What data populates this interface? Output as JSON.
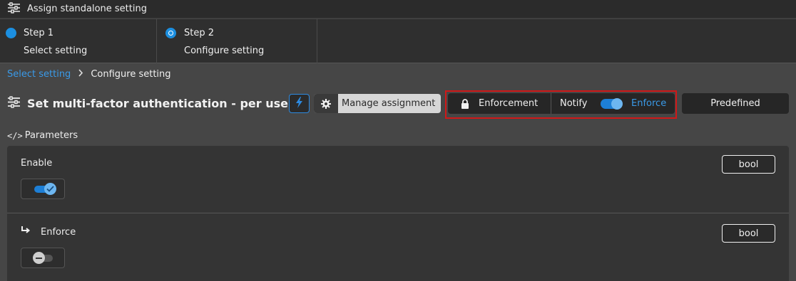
{
  "window": {
    "title": "Assign standalone setting",
    "icon": "sliders-icon"
  },
  "steps": [
    {
      "title": "Step 1",
      "subtitle": "Select setting",
      "state": "completed"
    },
    {
      "title": "Step 2",
      "subtitle": "Configure setting",
      "state": "current"
    }
  ],
  "breadcrumb": {
    "link": "Select setting",
    "current": "Configure setting"
  },
  "header": {
    "title": "Set multi-factor authentication - per user",
    "title_icon": "sliders-icon",
    "quick_action_icon": "lightning-icon",
    "manage_label": "Manage assignment",
    "manage_icon": "gear-icon"
  },
  "enforcement": {
    "label": "Enforcement",
    "icon": "lock-icon",
    "notify_label": "Notify",
    "enforce_label": "Enforce",
    "mode": "Enforce"
  },
  "predefined_label": "Predefined",
  "parameters": {
    "heading": "Parameters",
    "heading_icon": "code-icon",
    "items": [
      {
        "label": "Enable",
        "type": "bool",
        "value": true
      },
      {
        "label": "Enforce",
        "type": "bool",
        "value": false,
        "icon": "subitem-arrow-icon"
      }
    ]
  },
  "colors": {
    "accent": "#1c8fe0",
    "highlight": "#d01818",
    "background": "#464646"
  }
}
